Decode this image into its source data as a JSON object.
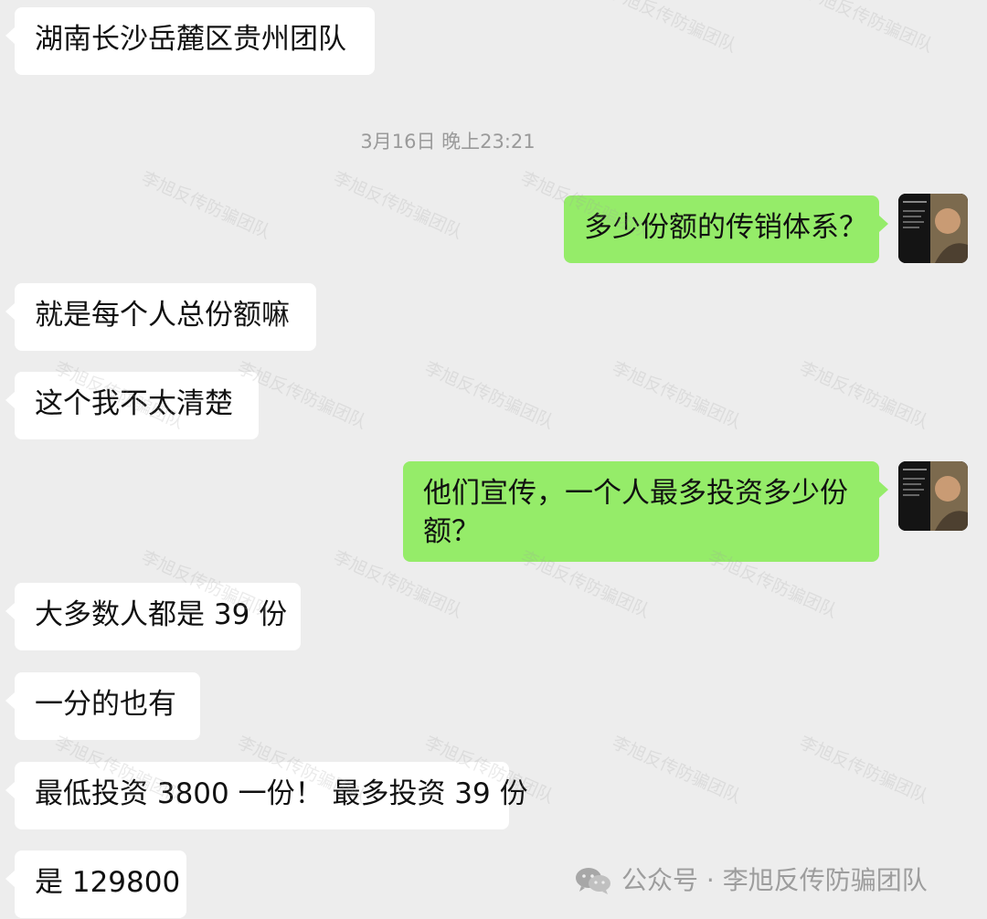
{
  "timestamp": "3月16日 晚上23:21",
  "messages": [
    {
      "text": "湖南长沙岳麓区贵州团队"
    },
    {
      "text": "多少份额的传销体系？"
    },
    {
      "text": "就是每个人总份额嘛"
    },
    {
      "text": "这个我不太清楚"
    },
    {
      "text": "他们宣传，一个人最多投资多少份额？"
    },
    {
      "text": "大多数人都是 39 份"
    },
    {
      "text": "一分的也有"
    },
    {
      "text": "最低投资 3800 一份！ 最多投资 39 份"
    },
    {
      "text": "是 129800"
    }
  ],
  "watermark": {
    "text": "李旭反传防骗团队"
  },
  "footer": {
    "icon": "wechat-icon",
    "text": "公众号 · 李旭反传防骗团队"
  },
  "colors": {
    "background": "#ededed",
    "incoming": "#ffffff",
    "outgoing": "#95ec69",
    "timestamp": "#9a9a9a"
  }
}
